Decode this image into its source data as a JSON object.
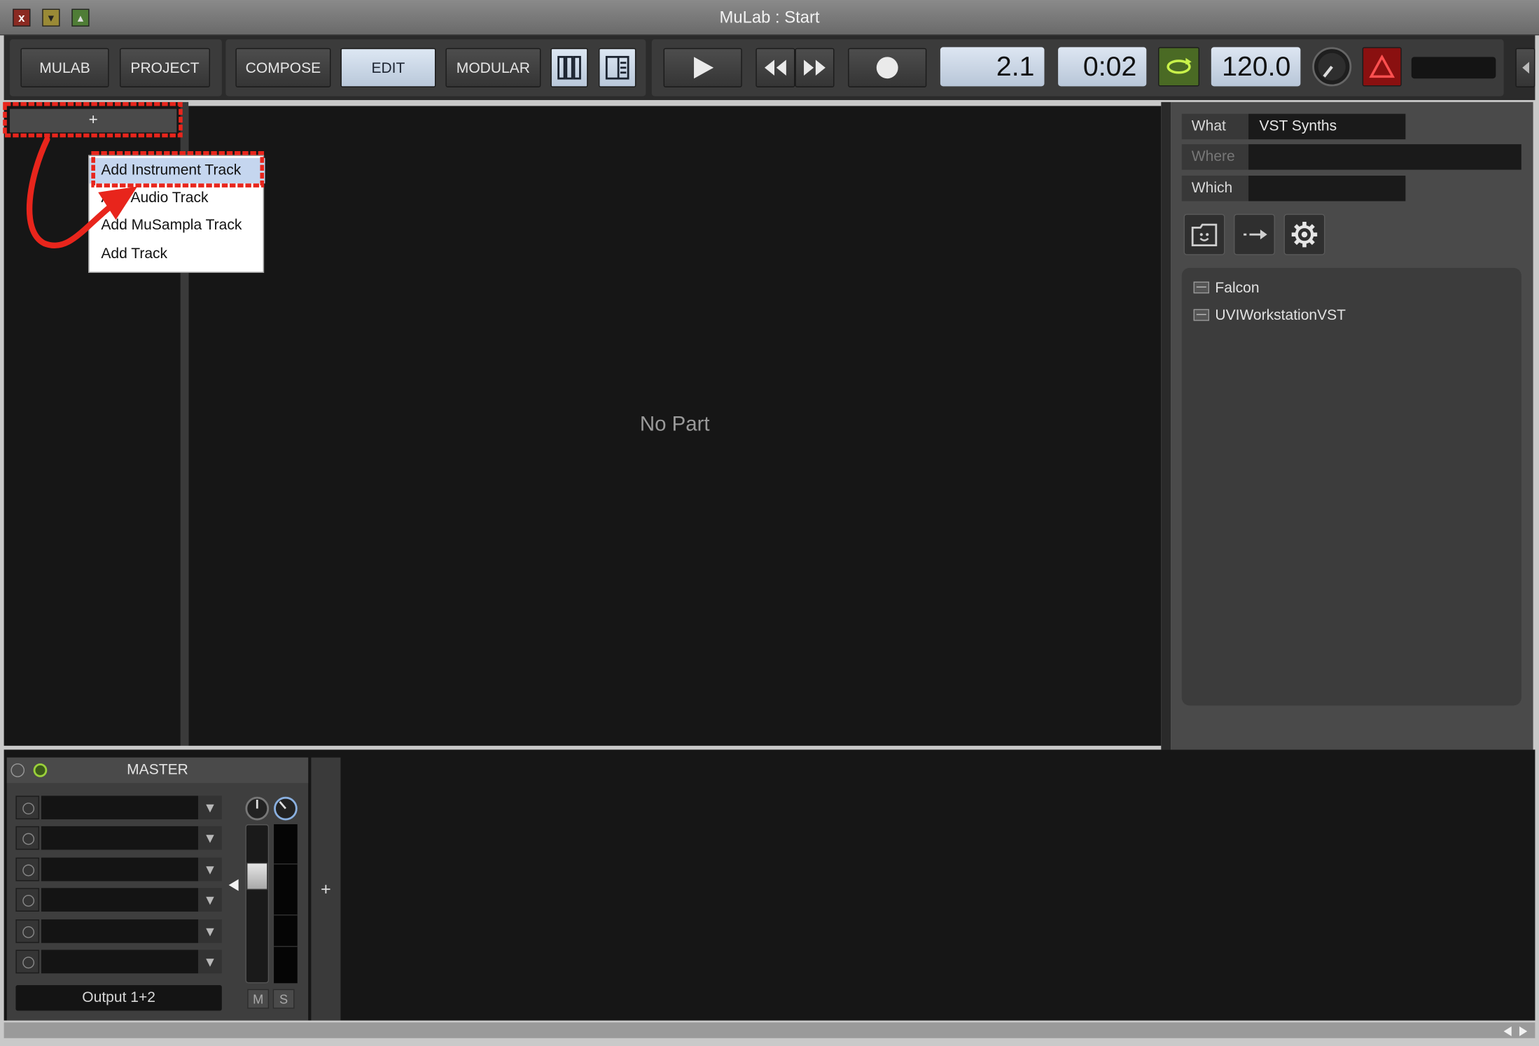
{
  "window": {
    "title": "MuLab : Start",
    "close": "x",
    "minimize": "▾",
    "maximize": "▴"
  },
  "toolbar": {
    "mulab": "MULAB",
    "project": "PROJECT",
    "compose": "COMPOSE",
    "edit": "EDIT",
    "modular": "MODULAR",
    "position": "2.1",
    "time": "0:02",
    "tempo": "120.0",
    "active_view": "EDIT"
  },
  "tracks": {
    "add_label": "+"
  },
  "context_menu": {
    "items": [
      {
        "label": "Add Instrument Track",
        "highlighted": true
      },
      {
        "label": "Add Audio Track"
      },
      {
        "label": "Add MuSampla Track"
      },
      {
        "label": "Add Track"
      }
    ]
  },
  "editor": {
    "empty_text": "No Part"
  },
  "browser": {
    "what_label": "What",
    "what_value": "VST Synths",
    "where_label": "Where",
    "where_value": "",
    "which_label": "Which",
    "which_value": "",
    "items": [
      {
        "label": "Falcon"
      },
      {
        "label": "UVIWorkstationVST"
      }
    ]
  },
  "mixer": {
    "master_title": "MASTER",
    "output": "Output 1+2",
    "mute": "M",
    "solo": "S",
    "add": "+"
  },
  "annotation": {
    "color": "#e8251c"
  },
  "colors": {
    "lcd": "#c9d6e6",
    "loop_active": "#7aa83a",
    "alert": "#b51d1d"
  }
}
